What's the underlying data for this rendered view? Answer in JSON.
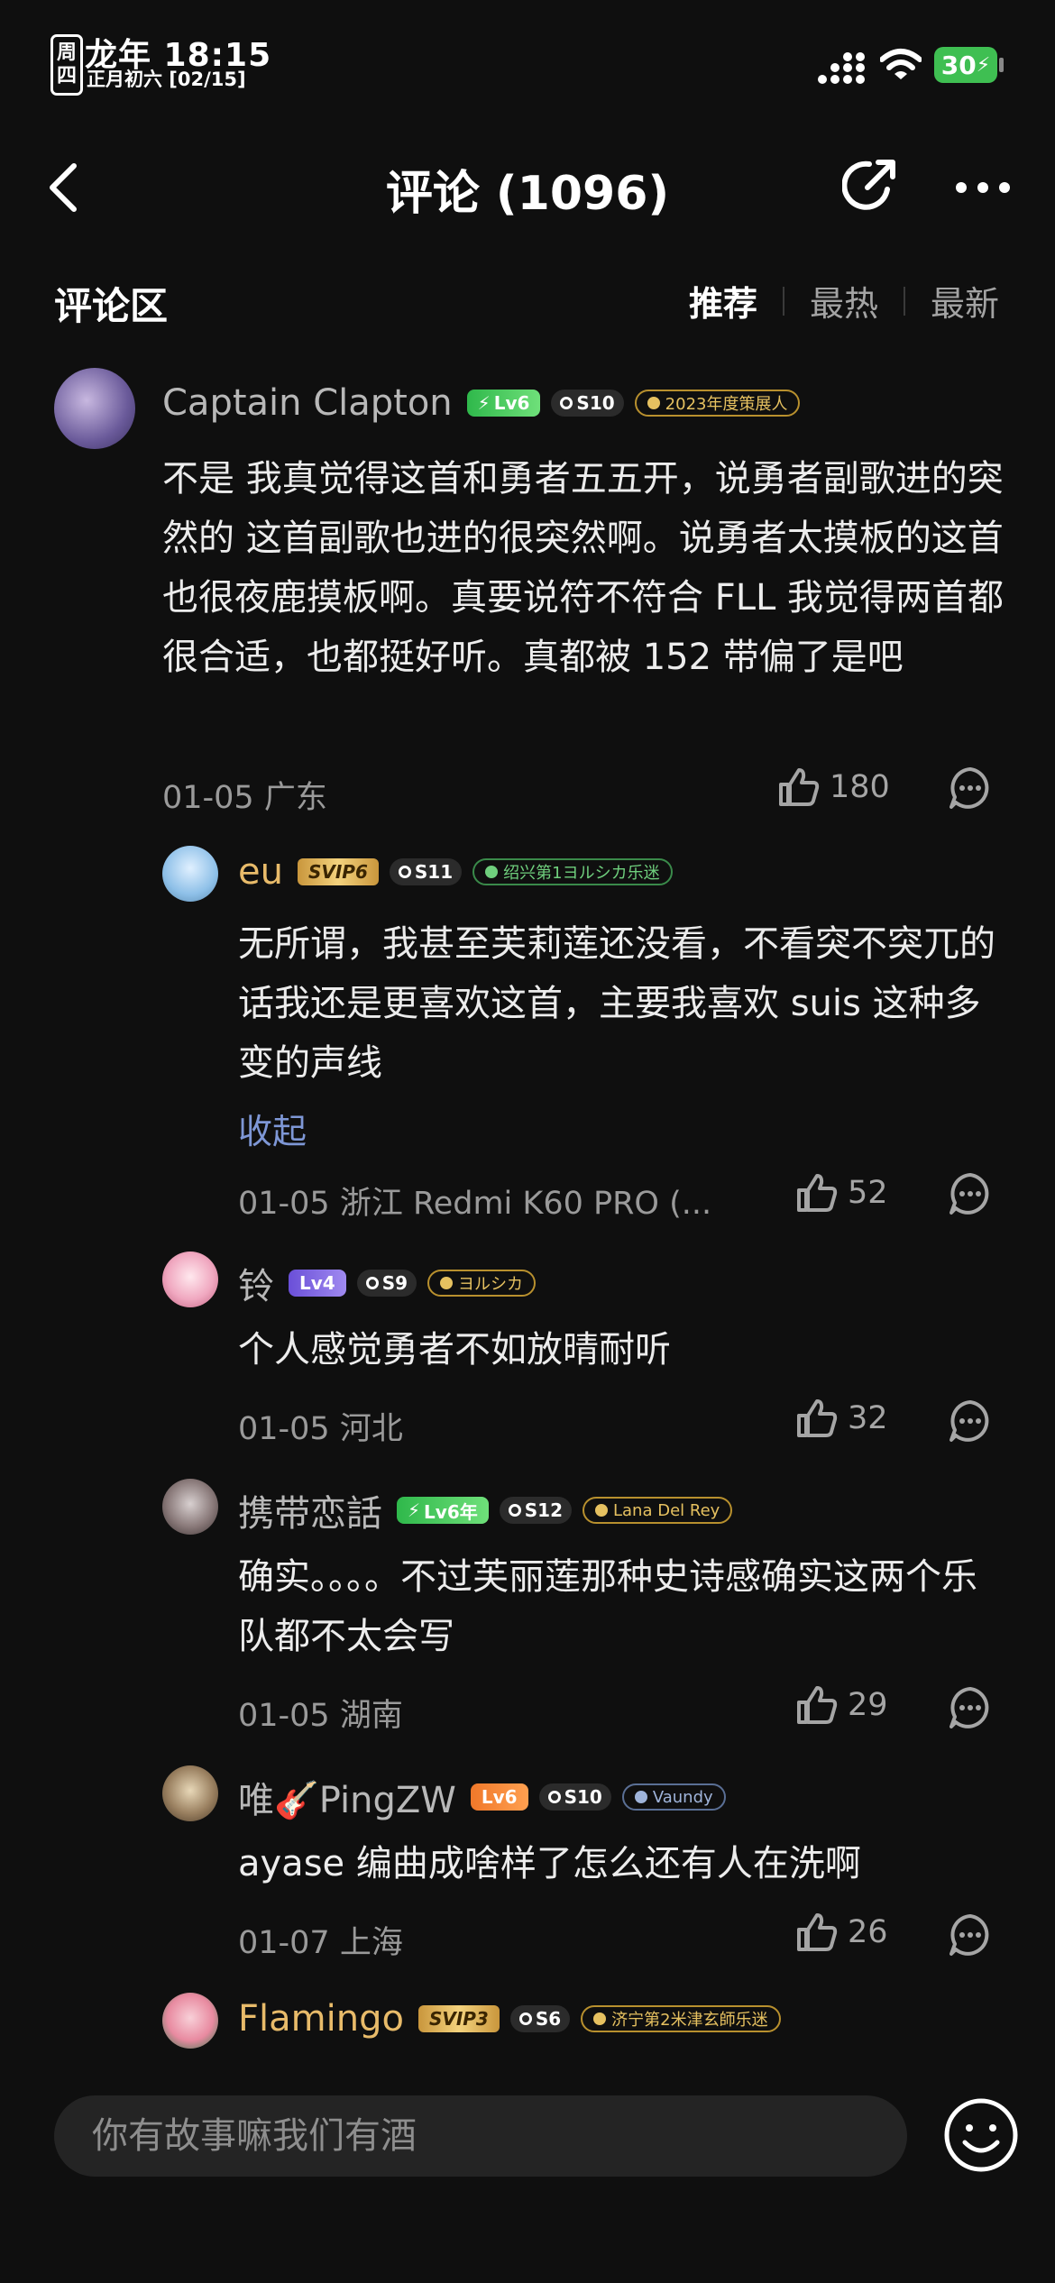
{
  "status_bar": {
    "weekday_chars": [
      "周",
      "四"
    ],
    "time": "龙年 18:15",
    "lunar_date": "正月初六 [02/15]",
    "battery": "30"
  },
  "header": {
    "title": "评论 (1096)",
    "back_icon": "chevron-left-icon",
    "share_icon": "share-icon",
    "more_icon": "more-icon"
  },
  "section": {
    "title": "评论区",
    "sort_tabs": [
      "推荐",
      "最热",
      "最新"
    ],
    "active_tab": "推荐"
  },
  "comments": [
    {
      "user": "Captain Clapton",
      "level": "Lv6",
      "s_level": "S10",
      "tag": "2023年度策展人",
      "text": "不是 我真觉得这首和勇者五五开，说勇者副歌进的突然的 这首副歌也进的很突然啊。说勇者太摸板的这首也很夜鹿摸板啊。真要说符不符合 FLL 我觉得两首都很合适，也都挺好听。真都被 152 带偏了是吧",
      "meta": "01-05 广东",
      "likes": "180"
    }
  ],
  "replies": [
    {
      "user": "eu",
      "vip": "SVIP6",
      "s_level": "S11",
      "tag": "绍兴第1ヨルシカ乐迷",
      "text": "无所谓，我甚至芙莉莲还没看，不看突不突兀的话我还是更喜欢这首，主要我喜欢 suis 这种多变的声线",
      "expand": "收起",
      "meta": "01-05 浙江  Redmi K60 PRO (...",
      "likes": "52"
    },
    {
      "user": "铃",
      "level": "Lv4",
      "s_level": "S9",
      "tag": "ヨルシカ",
      "text": "个人感觉勇者不如放晴耐听",
      "meta": "01-05 河北",
      "likes": "32"
    },
    {
      "user": "携带恋話",
      "level": "Lv6年",
      "s_level": "S12",
      "tag": "Lana Del Rey",
      "text": "确实。。。。不过芙丽莲那种史诗感确实这两个乐队都不太会写",
      "meta": "01-05 湖南",
      "likes": "29"
    },
    {
      "user": "唯🎸PingZW",
      "level": "Lv6",
      "s_level": "S10",
      "tag": "Vaundy",
      "text": "ayase 编曲成啥样了怎么还有人在洗啊",
      "meta": "01-07 上海",
      "likes": "26"
    },
    {
      "user": "Flamingo",
      "vip": "SVIP3",
      "s_level": "S6",
      "tag": "济宁第2米津玄師乐迷"
    }
  ],
  "input": {
    "placeholder": "你有故事嘛我们有酒",
    "emoji_icon": "smile-icon"
  },
  "colors": {
    "background": "#0f0f0f",
    "vip_name": "#e8bb6a",
    "link": "#7e97d6"
  }
}
